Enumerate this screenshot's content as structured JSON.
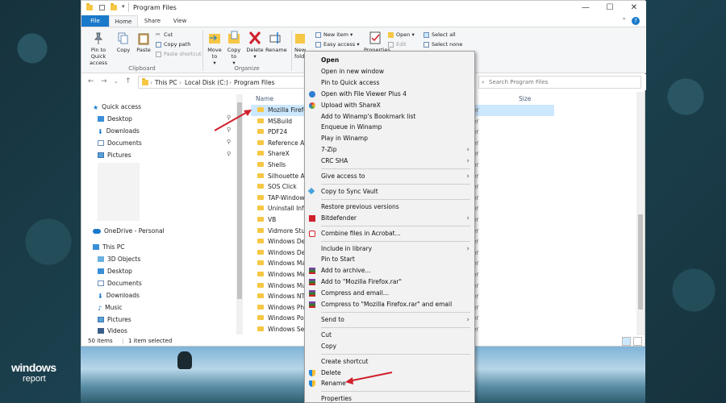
{
  "window": {
    "title": "Program Files",
    "minimize": "—",
    "maximize": "☐",
    "close": "✕"
  },
  "ribbon_tabs": [
    "File",
    "Home",
    "Share",
    "View"
  ],
  "ribbon": {
    "pin_to_quick_access": "Pin to Quick access",
    "copy": "Copy",
    "paste": "Paste",
    "cut": "Cut",
    "copy_path": "Copy path",
    "paste_shortcut": "Paste shortcut",
    "clipboard_group": "Clipboard",
    "move_to": "Move to",
    "copy_to": "Copy to",
    "delete": "Delete",
    "rename": "Rename",
    "new_folder": "New folder",
    "organize_group": "Organize",
    "new_item": "New item",
    "easy_access": "Easy access",
    "properties": "Properties",
    "open": "Open",
    "edit": "Edit",
    "select_all": "Select all",
    "select_none": "Select none"
  },
  "address": {
    "crumbs": [
      "This PC",
      "Local Disk (C:)",
      "Program Files"
    ],
    "search_placeholder": "Search Program Files"
  },
  "nav_pane": {
    "quick_access": "Quick access",
    "items": [
      "Desktop",
      "Downloads",
      "Documents",
      "Pictures"
    ],
    "onedrive": "OneDrive - Personal",
    "this_pc": "This PC",
    "pc_items": [
      "3D Objects",
      "Desktop",
      "Documents",
      "Downloads",
      "Music",
      "Pictures",
      "Videos"
    ]
  },
  "file_list": {
    "col_name": "Name",
    "col_size": "Size",
    "type_text": "der",
    "files": [
      "Mozilla Firefox",
      "MSBuild",
      "PDF24",
      "Reference Asse",
      "ShareX",
      "Shells",
      "Silhouette Ame",
      "SOS Click",
      "TAP-Windows",
      "Uninstall Inform",
      "VB",
      "Vidmore Studi",
      "Windows Defe",
      "Windows Defe",
      "Windows Mail",
      "Windows Med",
      "Windows Mult",
      "Windows NT",
      "Windows Phot",
      "Windows Porta",
      "Windows Secu"
    ]
  },
  "status": {
    "item_count": "50 items",
    "selected": "1 item selected"
  },
  "context_menu": [
    {
      "label": "Open",
      "bold": true
    },
    {
      "label": "Open in new window"
    },
    {
      "label": "Pin to Quick access"
    },
    {
      "label": "Open with File Viewer Plus 4",
      "icon": "file-viewer-icon"
    },
    {
      "label": "Upload with ShareX",
      "icon": "sharex-icon"
    },
    {
      "label": "Add to Winamp's Bookmark list"
    },
    {
      "label": "Enqueue in Winamp"
    },
    {
      "label": "Play in Winamp"
    },
    {
      "label": "7-Zip",
      "submenu": true
    },
    {
      "label": "CRC SHA",
      "submenu": true
    },
    {
      "sep": true
    },
    {
      "label": "Give access to",
      "submenu": true
    },
    {
      "sep": true
    },
    {
      "label": "Copy to Sync Vault",
      "icon": "sync-vault-icon"
    },
    {
      "sep": true
    },
    {
      "label": "Restore previous versions"
    },
    {
      "label": "Bitdefender",
      "submenu": true,
      "icon": "bitdefender-icon"
    },
    {
      "sep": true
    },
    {
      "label": "Combine files in Acrobat...",
      "icon": "acrobat-icon"
    },
    {
      "sep": true
    },
    {
      "label": "Include in library",
      "submenu": true
    },
    {
      "label": "Pin to Start"
    },
    {
      "label": "Add to archive...",
      "icon": "winrar-icon"
    },
    {
      "label": "Add to \"Mozilla Firefox.rar\"",
      "icon": "winrar-icon"
    },
    {
      "label": "Compress and email...",
      "icon": "winrar-icon"
    },
    {
      "label": "Compress to \"Mozilla Firefox.rar\" and email",
      "icon": "winrar-icon"
    },
    {
      "sep": true
    },
    {
      "label": "Send to",
      "submenu": true
    },
    {
      "sep": true
    },
    {
      "label": "Cut"
    },
    {
      "label": "Copy"
    },
    {
      "sep": true
    },
    {
      "label": "Create shortcut"
    },
    {
      "label": "Delete",
      "icon": "shield-icon"
    },
    {
      "label": "Rename",
      "icon": "shield-icon"
    },
    {
      "sep": true
    },
    {
      "label": "Properties"
    }
  ],
  "watermark": {
    "line1": "windows",
    "line2": "report"
  },
  "colors": {
    "accent": "#1979ca",
    "selection": "#cce8ff",
    "annotation_arrow": "#d0202c",
    "folder": "#f6c744"
  }
}
